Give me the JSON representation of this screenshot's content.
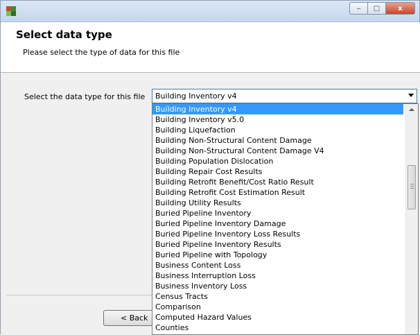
{
  "window": {
    "controls": {
      "minimize": "‒",
      "maximize": "□",
      "close": "x"
    }
  },
  "header": {
    "title": "Select data type",
    "subtitle": "Please select the type of data for this file"
  },
  "form": {
    "label": "Select the data type for this file",
    "selected_value": "Building Inventory v4"
  },
  "dropdown": {
    "options": [
      "Building Inventory v4",
      "Building Inventory v5.0",
      "Building Liquefaction",
      "Building Non-Structural Content Damage",
      "Building Non-Structural Content Damage V4",
      "Building Population Dislocation",
      "Building Repair Cost Results",
      "Building Retrofit Benefit/Cost Ratio Result",
      "Building Retrofit Cost Estimation Result",
      "Building Utility Results",
      "Buried Pipeline Inventory",
      "Buried Pipeline Inventory Damage",
      "Buried Pipeline Inventory Loss Results",
      "Buried Pipeline Inventory Results",
      "Buried Pipeline with Topology",
      "Business Content Loss",
      "Business Interruption Loss",
      "Business Inventory Loss",
      "Census Tracts",
      "Comparison",
      "Computed Hazard Values",
      "Counties"
    ],
    "selected_index": 0
  },
  "buttons": {
    "back_label": "< Back"
  },
  "colors": {
    "selection": "#3399ff",
    "combo_border": "#3c7fb1",
    "close_button": "#c8472b"
  }
}
